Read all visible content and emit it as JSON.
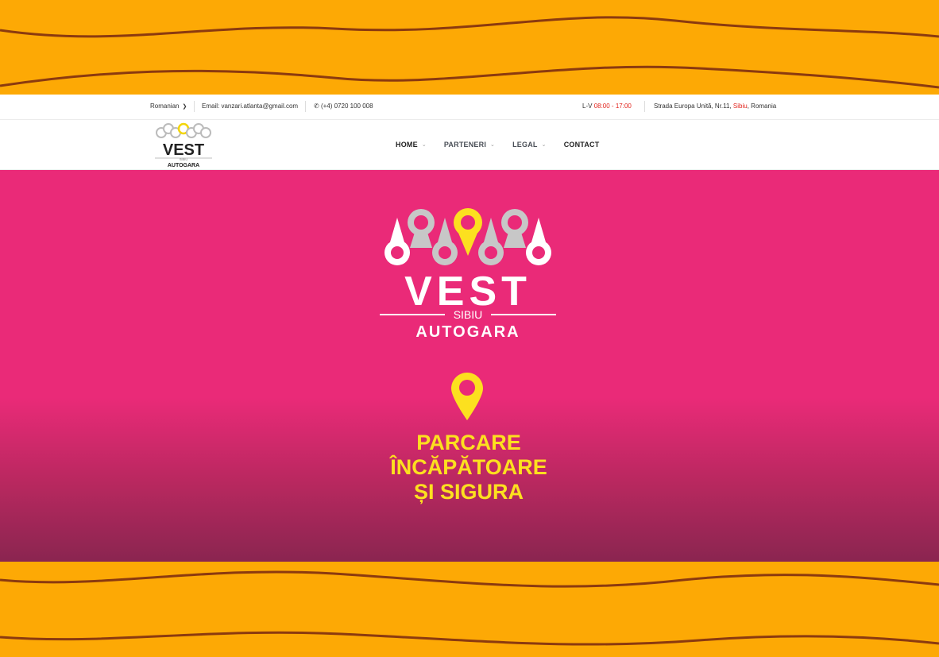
{
  "topbar": {
    "language": "Romanian",
    "email": "Email: vanzari.atlanta@gmail.com",
    "phone": "(+4) 0720 100 008",
    "hours_prefix": "L-V",
    "hours_value": "08:00 - 17:00",
    "address_street": "Strada Europa Unită, Nr.11,",
    "address_city": "Sibiu",
    "address_country": ", Romania"
  },
  "logo": {
    "title": "VEST",
    "subtitle": "SIBIU",
    "tagline": "AUTOGARA"
  },
  "nav": {
    "items": [
      {
        "label": "HOME"
      },
      {
        "label": "PARTENERI"
      },
      {
        "label": "LEGAL"
      },
      {
        "label": "CONTACT"
      }
    ]
  },
  "hero": {
    "slogan_line1": "PARCARE",
    "slogan_line2": "ÎNCĂPĂTOARE",
    "slogan_line3": "ȘI SIGURA"
  },
  "colors": {
    "frame": "#fda905",
    "wave_line": "#8b3a0f",
    "hero_pink": "#ea2a78",
    "accent_yellow": "#fce01f",
    "highlight_red": "#e2261f"
  }
}
